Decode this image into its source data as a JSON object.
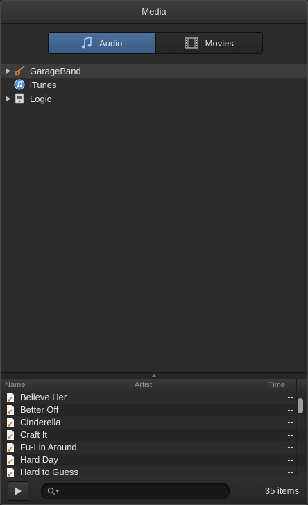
{
  "window": {
    "title": "Media"
  },
  "segmented": {
    "audio_label": "Audio",
    "movies_label": "Movies",
    "active": "audio",
    "active_color": "#3f6590"
  },
  "tree": [
    {
      "label": "GarageBand",
      "has_children": true,
      "selected": true,
      "icon": "guitar-icon"
    },
    {
      "label": "iTunes",
      "has_children": false,
      "selected": false,
      "icon": "itunes-icon"
    },
    {
      "label": "Logic",
      "has_children": true,
      "selected": false,
      "icon": "logic-icon"
    }
  ],
  "table": {
    "columns": {
      "name": "Name",
      "artist": "Artist",
      "time": "Time"
    },
    "rows": [
      {
        "name": "Believe Her",
        "artist": "",
        "time": "--"
      },
      {
        "name": "Better Off",
        "artist": "",
        "time": "--"
      },
      {
        "name": "Cinderella",
        "artist": "",
        "time": "--"
      },
      {
        "name": "Craft It",
        "artist": "",
        "time": "--"
      },
      {
        "name": "Fu-Lin Around",
        "artist": "",
        "time": "--"
      },
      {
        "name": "Hard Day",
        "artist": "",
        "time": "--"
      },
      {
        "name": "Hard to Guess",
        "artist": "",
        "time": "--"
      }
    ]
  },
  "footer": {
    "item_count": "35 items",
    "search_value": ""
  }
}
